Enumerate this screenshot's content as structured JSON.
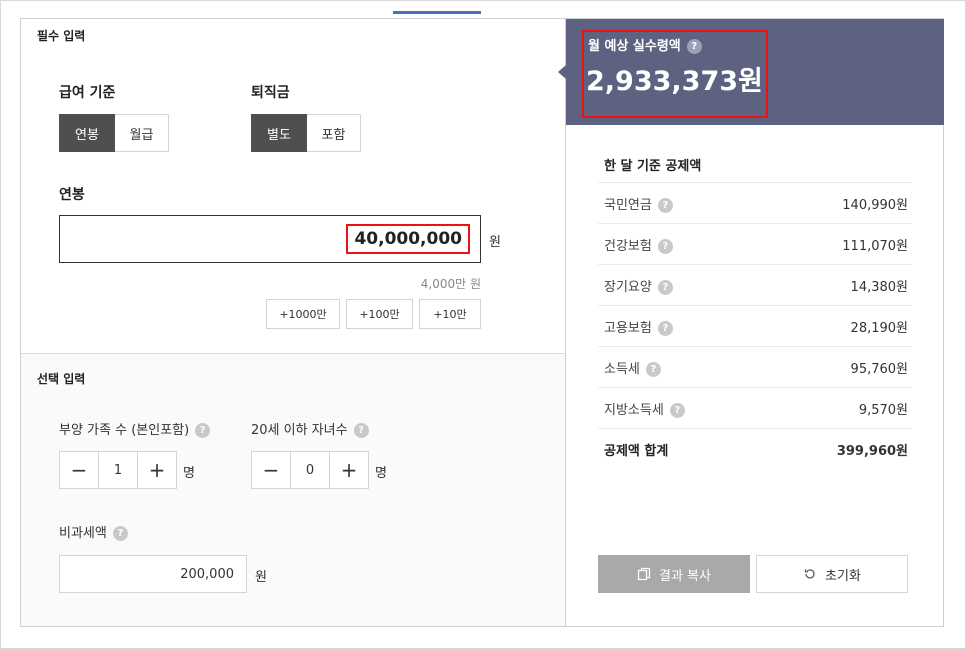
{
  "required": {
    "title": "필수 입력",
    "pay_basis": {
      "label": "급여 기준",
      "options": [
        "연봉",
        "월급"
      ],
      "selected": 0
    },
    "severance": {
      "label": "퇴직금",
      "options": [
        "별도",
        "포함"
      ],
      "selected": 0
    },
    "salary": {
      "label": "연봉",
      "value": "40,000,000",
      "unit": "원",
      "helper": "4,000만 원",
      "increments": [
        "+1000만",
        "+100만",
        "+10만"
      ]
    }
  },
  "optional": {
    "title": "선택 입력",
    "dependents": {
      "label": "부양 가족 수 (본인포함)",
      "value": "1",
      "unit": "명"
    },
    "children": {
      "label": "20세 이하 자녀수",
      "value": "0",
      "unit": "명"
    },
    "nontax": {
      "label": "비과세액",
      "value": "200,000",
      "unit": "원"
    }
  },
  "result": {
    "label": "월 예상 실수령액",
    "value": "2,933,373원",
    "deduction_title": "한 달 기준 공제액",
    "deductions": [
      {
        "label": "국민연금",
        "amount": "140,990원"
      },
      {
        "label": "건강보험",
        "amount": "111,070원"
      },
      {
        "label": "장기요양",
        "amount": "14,380원"
      },
      {
        "label": "고용보험",
        "amount": "28,190원"
      },
      {
        "label": "소득세",
        "amount": "95,760원"
      },
      {
        "label": "지방소득세",
        "amount": "9,570원"
      }
    ],
    "total": {
      "label": "공제액 합계",
      "amount": "399,960원"
    },
    "copy_label": "결과 복사",
    "reset_label": "초기화"
  },
  "icons": {
    "help": "?",
    "minus": "−",
    "plus": "+"
  },
  "colors": {
    "result_bg": "#5d6280",
    "highlight": "#ee1111",
    "active_toggle": "#4f4f4f"
  }
}
